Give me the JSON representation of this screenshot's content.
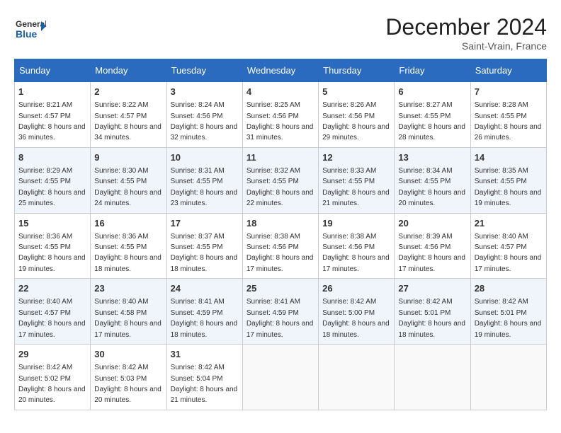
{
  "logo": {
    "general": "General",
    "blue": "Blue"
  },
  "header": {
    "month": "December 2024",
    "location": "Saint-Vrain, France"
  },
  "days_of_week": [
    "Sunday",
    "Monday",
    "Tuesday",
    "Wednesday",
    "Thursday",
    "Friday",
    "Saturday"
  ],
  "weeks": [
    [
      {
        "day": "1",
        "sunrise": "8:21 AM",
        "sunset": "4:57 PM",
        "daylight": "8 hours and 36 minutes."
      },
      {
        "day": "2",
        "sunrise": "8:22 AM",
        "sunset": "4:57 PM",
        "daylight": "8 hours and 34 minutes."
      },
      {
        "day": "3",
        "sunrise": "8:24 AM",
        "sunset": "4:56 PM",
        "daylight": "8 hours and 32 minutes."
      },
      {
        "day": "4",
        "sunrise": "8:25 AM",
        "sunset": "4:56 PM",
        "daylight": "8 hours and 31 minutes."
      },
      {
        "day": "5",
        "sunrise": "8:26 AM",
        "sunset": "4:56 PM",
        "daylight": "8 hours and 29 minutes."
      },
      {
        "day": "6",
        "sunrise": "8:27 AM",
        "sunset": "4:55 PM",
        "daylight": "8 hours and 28 minutes."
      },
      {
        "day": "7",
        "sunrise": "8:28 AM",
        "sunset": "4:55 PM",
        "daylight": "8 hours and 26 minutes."
      }
    ],
    [
      {
        "day": "8",
        "sunrise": "8:29 AM",
        "sunset": "4:55 PM",
        "daylight": "8 hours and 25 minutes."
      },
      {
        "day": "9",
        "sunrise": "8:30 AM",
        "sunset": "4:55 PM",
        "daylight": "8 hours and 24 minutes."
      },
      {
        "day": "10",
        "sunrise": "8:31 AM",
        "sunset": "4:55 PM",
        "daylight": "8 hours and 23 minutes."
      },
      {
        "day": "11",
        "sunrise": "8:32 AM",
        "sunset": "4:55 PM",
        "daylight": "8 hours and 22 minutes."
      },
      {
        "day": "12",
        "sunrise": "8:33 AM",
        "sunset": "4:55 PM",
        "daylight": "8 hours and 21 minutes."
      },
      {
        "day": "13",
        "sunrise": "8:34 AM",
        "sunset": "4:55 PM",
        "daylight": "8 hours and 20 minutes."
      },
      {
        "day": "14",
        "sunrise": "8:35 AM",
        "sunset": "4:55 PM",
        "daylight": "8 hours and 19 minutes."
      }
    ],
    [
      {
        "day": "15",
        "sunrise": "8:36 AM",
        "sunset": "4:55 PM",
        "daylight": "8 hours and 19 minutes."
      },
      {
        "day": "16",
        "sunrise": "8:36 AM",
        "sunset": "4:55 PM",
        "daylight": "8 hours and 18 minutes."
      },
      {
        "day": "17",
        "sunrise": "8:37 AM",
        "sunset": "4:55 PM",
        "daylight": "8 hours and 18 minutes."
      },
      {
        "day": "18",
        "sunrise": "8:38 AM",
        "sunset": "4:56 PM",
        "daylight": "8 hours and 17 minutes."
      },
      {
        "day": "19",
        "sunrise": "8:38 AM",
        "sunset": "4:56 PM",
        "daylight": "8 hours and 17 minutes."
      },
      {
        "day": "20",
        "sunrise": "8:39 AM",
        "sunset": "4:56 PM",
        "daylight": "8 hours and 17 minutes."
      },
      {
        "day": "21",
        "sunrise": "8:40 AM",
        "sunset": "4:57 PM",
        "daylight": "8 hours and 17 minutes."
      }
    ],
    [
      {
        "day": "22",
        "sunrise": "8:40 AM",
        "sunset": "4:57 PM",
        "daylight": "8 hours and 17 minutes."
      },
      {
        "day": "23",
        "sunrise": "8:40 AM",
        "sunset": "4:58 PM",
        "daylight": "8 hours and 17 minutes."
      },
      {
        "day": "24",
        "sunrise": "8:41 AM",
        "sunset": "4:59 PM",
        "daylight": "8 hours and 18 minutes."
      },
      {
        "day": "25",
        "sunrise": "8:41 AM",
        "sunset": "4:59 PM",
        "daylight": "8 hours and 17 minutes."
      },
      {
        "day": "26",
        "sunrise": "8:42 AM",
        "sunset": "5:00 PM",
        "daylight": "8 hours and 18 minutes."
      },
      {
        "day": "27",
        "sunrise": "8:42 AM",
        "sunset": "5:01 PM",
        "daylight": "8 hours and 18 minutes."
      },
      {
        "day": "28",
        "sunrise": "8:42 AM",
        "sunset": "5:01 PM",
        "daylight": "8 hours and 19 minutes."
      }
    ],
    [
      {
        "day": "29",
        "sunrise": "8:42 AM",
        "sunset": "5:02 PM",
        "daylight": "8 hours and 20 minutes."
      },
      {
        "day": "30",
        "sunrise": "8:42 AM",
        "sunset": "5:03 PM",
        "daylight": "8 hours and 20 minutes."
      },
      {
        "day": "31",
        "sunrise": "8:42 AM",
        "sunset": "5:04 PM",
        "daylight": "8 hours and 21 minutes."
      },
      null,
      null,
      null,
      null
    ]
  ]
}
